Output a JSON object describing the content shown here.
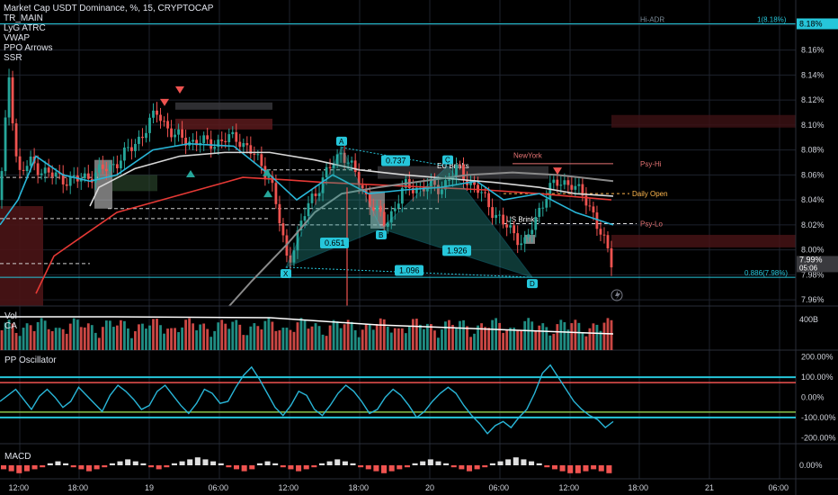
{
  "header": {
    "title": "Market Cap USDT Dominance, %, 15, CRYPTOCAP",
    "indicators": [
      "TR_MAIN",
      "LyG ATRC",
      "VWAP",
      "PPO Arrows",
      "SSR"
    ]
  },
  "colors": {
    "background": "#000000",
    "up": "#26a69a",
    "down": "#ef5350",
    "cyan": "#29b6d8",
    "red_ma": "#e53935",
    "white_ma": "#d8d8d8",
    "gray_ma": "#8a8a8a",
    "grid": "#1e222d",
    "axis_text": "#d1d4dc",
    "hi_adr": "#26c6da",
    "osc_band_top": "#ef5350",
    "osc_band_bottom": "#26c6da",
    "osc_zero": "#8bc34a"
  },
  "chart_data": [
    {
      "type": "candlestick",
      "name": "price",
      "ylim": [
        7.955,
        8.19
      ],
      "y_ticks": [
        "8.18%",
        "8.16%",
        "8.14%",
        "8.12%",
        "8.10%",
        "8.08%",
        "8.06%",
        "8.04%",
        "8.02%",
        "8.00%",
        "7.98%",
        "7.96%"
      ],
      "y_tick_values": [
        8.18,
        8.16,
        8.14,
        8.12,
        8.1,
        8.08,
        8.06,
        8.04,
        8.02,
        8.0,
        7.98,
        7.96
      ],
      "x_tick_labels": [
        "12:00",
        "18:00",
        "19",
        "06:00",
        "12:00",
        "18:00",
        "20",
        "06:00",
        "12:00",
        "18:00",
        "21",
        "06:00"
      ],
      "last_price_label": "7.99%",
      "countdown_label": "05:06",
      "levels": [
        {
          "label": "Hi-ADR",
          "value": 8.181,
          "style": "solid"
        },
        {
          "label": "1(8.18%)",
          "value": 8.181,
          "style": "label"
        },
        {
          "label": "0.886(7.98%)",
          "value": 7.978,
          "style": "solid"
        },
        {
          "label": "Psy-Hi",
          "value": 8.069,
          "style": "solid"
        },
        {
          "label": "Daily Open",
          "value": 8.045,
          "style": "dashed"
        },
        {
          "label": "Psy-Lo",
          "value": 8.021,
          "style": "dashed"
        },
        {
          "label": "NewYork",
          "value": 8.073,
          "style": "session"
        },
        {
          "label": "EU Brinks",
          "value": 8.066,
          "style": "session"
        },
        {
          "label": "US Brinks",
          "value": 8.024,
          "style": "session"
        }
      ],
      "harmonic": {
        "points": [
          {
            "label": "X",
            "value": 7.986
          },
          {
            "label": "A",
            "value": 8.082
          },
          {
            "label": "B",
            "value": 8.017
          },
          {
            "label": "C",
            "value": 8.067
          },
          {
            "label": "D",
            "value": 7.978
          }
        ],
        "ratios": [
          "0.737",
          "0.651",
          "1.926",
          "1.096"
        ]
      }
    },
    {
      "type": "bar",
      "name": "volume",
      "legend": [
        "Vol",
        "CA"
      ],
      "y_ticks": [
        "400B"
      ]
    },
    {
      "type": "line",
      "name": "PP Oscillator",
      "ylim": [
        -230,
        230
      ],
      "y_ticks": [
        "200.00%",
        "100.00%",
        "0.00%",
        "-100.00%",
        "-200.00%"
      ],
      "y_tick_values": [
        200,
        100,
        0,
        -100,
        -200
      ],
      "band_top": 100,
      "band_bottom": -100,
      "values": [
        -20,
        10,
        40,
        -10,
        -60,
        5,
        40,
        0,
        -50,
        -20,
        50,
        10,
        -30,
        -70,
        10,
        60,
        30,
        -10,
        -60,
        -40,
        30,
        60,
        10,
        -40,
        -80,
        -30,
        40,
        20,
        -30,
        -20,
        50,
        110,
        150,
        90,
        20,
        -50,
        -90,
        -40,
        30,
        10,
        -60,
        -90,
        -40,
        20,
        60,
        30,
        -20,
        -80,
        -60,
        0,
        40,
        10,
        -40,
        -100,
        -70,
        -20,
        20,
        50,
        20,
        -40,
        -90,
        -130,
        -180,
        -140,
        -120,
        -150,
        -100,
        -60,
        20,
        120,
        160,
        100,
        40,
        -20,
        -60,
        -90,
        -110,
        -150,
        -120
      ]
    },
    {
      "type": "bar",
      "name": "MACD",
      "legend": [
        "MACD"
      ],
      "y_ticks": [
        "0.00%"
      ],
      "values": [
        -2,
        -3,
        -4,
        -3,
        -2,
        -1,
        1,
        2,
        1,
        -1,
        -2,
        -3,
        -2,
        -1,
        1,
        2,
        3,
        2,
        1,
        -1,
        -2,
        -1,
        1,
        2,
        3,
        4,
        3,
        2,
        1,
        -1,
        -2,
        -3,
        -2,
        1,
        2,
        1,
        -1,
        -2,
        -3,
        -2,
        -1,
        1,
        2,
        3,
        2,
        1,
        -1,
        -2,
        -3,
        -4,
        -3,
        -2,
        -1,
        1,
        2,
        3,
        2,
        1,
        -1,
        -2,
        -3,
        -2,
        -1,
        1,
        2,
        3,
        4,
        3,
        2,
        1,
        -1,
        -2,
        -3,
        -4,
        -4,
        -3,
        -2,
        -3,
        -4
      ]
    }
  ]
}
